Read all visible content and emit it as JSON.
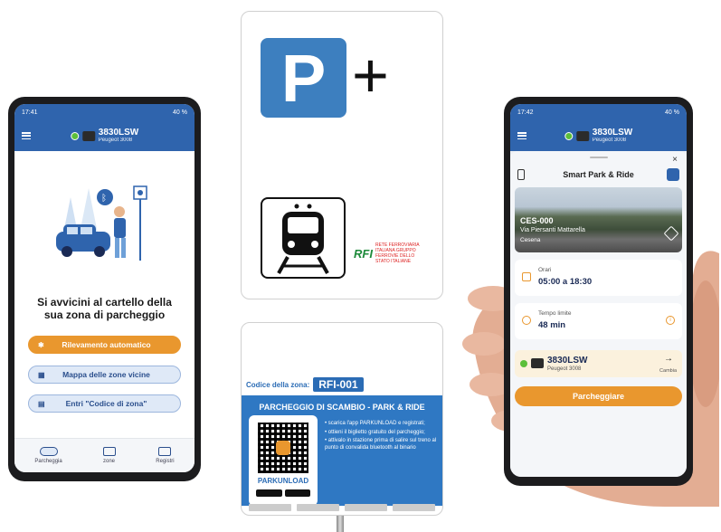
{
  "left_phone": {
    "status": {
      "time": "17:41",
      "battery": "40 %"
    },
    "vehicle": {
      "plate": "3830LSW",
      "model": "Peugeot 3008"
    },
    "heading": "Si avvicini al cartello della sua zona di parcheggio",
    "buttons": [
      {
        "label": "Rilevamento automatico"
      },
      {
        "label": "Mappa delle zone vicine"
      },
      {
        "label": "Entri \"Codice di zona\""
      }
    ],
    "nav": [
      {
        "label": "Parcheggia"
      },
      {
        "label": "zone"
      },
      {
        "label": "Registri"
      }
    ]
  },
  "sign_top": {
    "p_letter": "P",
    "plus": "+",
    "rfi_mark": "RFI",
    "rfi_text": "RETE FERROVIARIA ITALIANA GRUPPO FERROVIE DELLO STATO ITALIANE"
  },
  "sign_bottom": {
    "zone_label": "Codice della zona:",
    "zone_code": "RFI-001",
    "title": "PARCHEGGIO DI SCAMBIO - PARK & RIDE",
    "app_name": "PARKUNLOAD",
    "bullets": [
      "scarica l'app PARKUNLOAD e registrati;",
      "ottieni il biglietto gratuito del parcheggio;",
      "attivalo in stazione prima di salire sul treno al punto di convalida bluetooth al binario"
    ]
  },
  "right_phone": {
    "status": {
      "time": "17:42",
      "battery": "40 %"
    },
    "vehicle": {
      "plate": "3830LSW",
      "model": "Peugeot 3008"
    },
    "close": "×",
    "sheet_title": "Smart Park & Ride",
    "location": {
      "code": "CES-000",
      "address": "Via Piersanti Mattarella",
      "city": "Cesena"
    },
    "hours": {
      "label": "Orari",
      "value": "05:00 a 18:30"
    },
    "time_limit": {
      "label": "Tempo limite",
      "value": "48 min"
    },
    "vehicle_card": {
      "plate": "3830LSW",
      "model": "Peugeot 3008",
      "arrow": "→",
      "change": "Cambia"
    },
    "park_button": "Parcheggiare"
  },
  "colors": {
    "brand_blue": "#2f64ad",
    "accent_orange": "#e9972e",
    "sign_blue": "#3d7fbf"
  }
}
